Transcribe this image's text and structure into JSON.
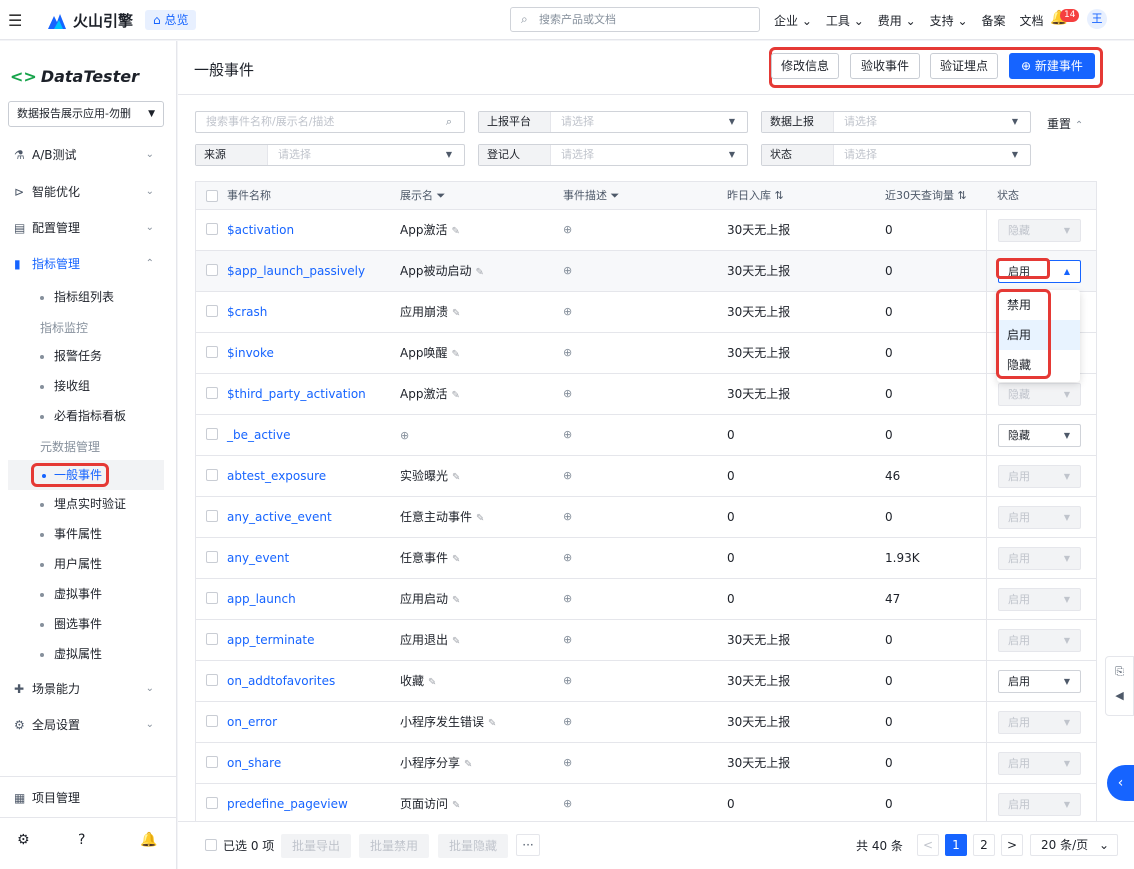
{
  "top": {
    "brand_name": "火山引擎",
    "overview": "总览",
    "search_placeholder": "搜索产品或文档",
    "nav": [
      "企业 ⌄",
      "工具 ⌄",
      "费用 ⌄",
      "支持 ⌄",
      "备案",
      "文档"
    ],
    "notif_count": "14",
    "avatar_initial": "王"
  },
  "sidebar": {
    "app_name": "DataTester",
    "app_select": "数据报告展示应用-勿删",
    "menu": [
      {
        "label": "A/B测试",
        "icon": "flask-icon"
      },
      {
        "label": "智能优化",
        "icon": "flow-icon"
      },
      {
        "label": "配置管理",
        "icon": "config-icon"
      },
      {
        "label": "指标管理",
        "icon": "chart-icon"
      }
    ],
    "metric_subs": [
      "指标组列表"
    ],
    "group_monitor": "指标监控",
    "monitor_subs": [
      "报警任务",
      "接收组",
      "必看指标看板"
    ],
    "group_meta": "元数据管理",
    "current": "一般事件",
    "meta_subs": [
      "埋点实时验证",
      "事件属性",
      "用户属性",
      "虚拟事件",
      "圈选事件",
      "虚拟属性"
    ],
    "menu2": [
      {
        "label": "场景能力",
        "icon": "puzzle-icon"
      },
      {
        "label": "全局设置",
        "icon": "gear-icon"
      }
    ],
    "project": "项目管理"
  },
  "main": {
    "title": "一般事件",
    "buttons": {
      "edit": "修改信息",
      "accept": "验收事件",
      "verify": "验证埋点",
      "create": "新建事件"
    },
    "filters": {
      "search_placeholder": "搜索事件名称/展示名/描述",
      "platform": "上报平台",
      "data_report": "数据上报",
      "source": "来源",
      "registrar": "登记人",
      "status": "状态",
      "select_placeholder": "请选择",
      "reset": "重置"
    },
    "columns": {
      "name": "事件名称",
      "display": "展示名",
      "desc": "事件描述",
      "yesterday": "昨日入库",
      "queries": "近30天查询量",
      "status": "状态"
    },
    "rows": [
      {
        "name": "$activation",
        "display": "App激活",
        "yesterday": "30天无上报",
        "queries": "0",
        "status": "隐藏",
        "enabled": false
      },
      {
        "name": "$app_launch_passively",
        "display": "App被动启动",
        "yesterday": "30天无上报",
        "queries": "0",
        "status": "启用",
        "enabled": true
      },
      {
        "name": "$crash",
        "display": "应用崩溃",
        "yesterday": "30天无上报",
        "queries": "0",
        "status": "",
        "enabled": false
      },
      {
        "name": "$invoke",
        "display": "App唤醒",
        "yesterday": "30天无上报",
        "queries": "0",
        "status": "",
        "enabled": false
      },
      {
        "name": "$third_party_activation",
        "display": "App激活",
        "yesterday": "30天无上报",
        "queries": "0",
        "status": "隐藏",
        "enabled": false
      },
      {
        "name": "_be_active",
        "display": "",
        "yesterday": "0",
        "queries": "0",
        "status": "隐藏",
        "enabled": true
      },
      {
        "name": "abtest_exposure",
        "display": "实验曝光",
        "yesterday": "0",
        "queries": "46",
        "status": "启用",
        "enabled": false
      },
      {
        "name": "any_active_event",
        "display": "任意主动事件",
        "yesterday": "0",
        "queries": "0",
        "status": "启用",
        "enabled": false
      },
      {
        "name": "any_event",
        "display": "任意事件",
        "yesterday": "0",
        "queries": "1.93K",
        "status": "启用",
        "enabled": false
      },
      {
        "name": "app_launch",
        "display": "应用启动",
        "yesterday": "0",
        "queries": "47",
        "status": "启用",
        "enabled": false
      },
      {
        "name": "app_terminate",
        "display": "应用退出",
        "yesterday": "30天无上报",
        "queries": "0",
        "status": "启用",
        "enabled": false
      },
      {
        "name": "on_addtofavorites",
        "display": "收藏",
        "yesterday": "30天无上报",
        "queries": "0",
        "status": "启用",
        "enabled": true
      },
      {
        "name": "on_error",
        "display": "小程序发生错误",
        "yesterday": "30天无上报",
        "queries": "0",
        "status": "启用",
        "enabled": false
      },
      {
        "name": "on_share",
        "display": "小程序分享",
        "yesterday": "30天无上报",
        "queries": "0",
        "status": "启用",
        "enabled": false
      },
      {
        "name": "predefine_pageview",
        "display": "页面访问",
        "yesterday": "0",
        "queries": "0",
        "status": "启用",
        "enabled": false
      }
    ],
    "dropdown": [
      "禁用",
      "启用",
      "隐藏"
    ],
    "footer": {
      "selected": "已选 0 项",
      "export": "批量导出",
      "disable": "批量禁用",
      "hide": "批量隐藏",
      "more": "···",
      "total": "共 40 条",
      "page1": "1",
      "page2": "2",
      "page_size": "20 条/页"
    }
  }
}
